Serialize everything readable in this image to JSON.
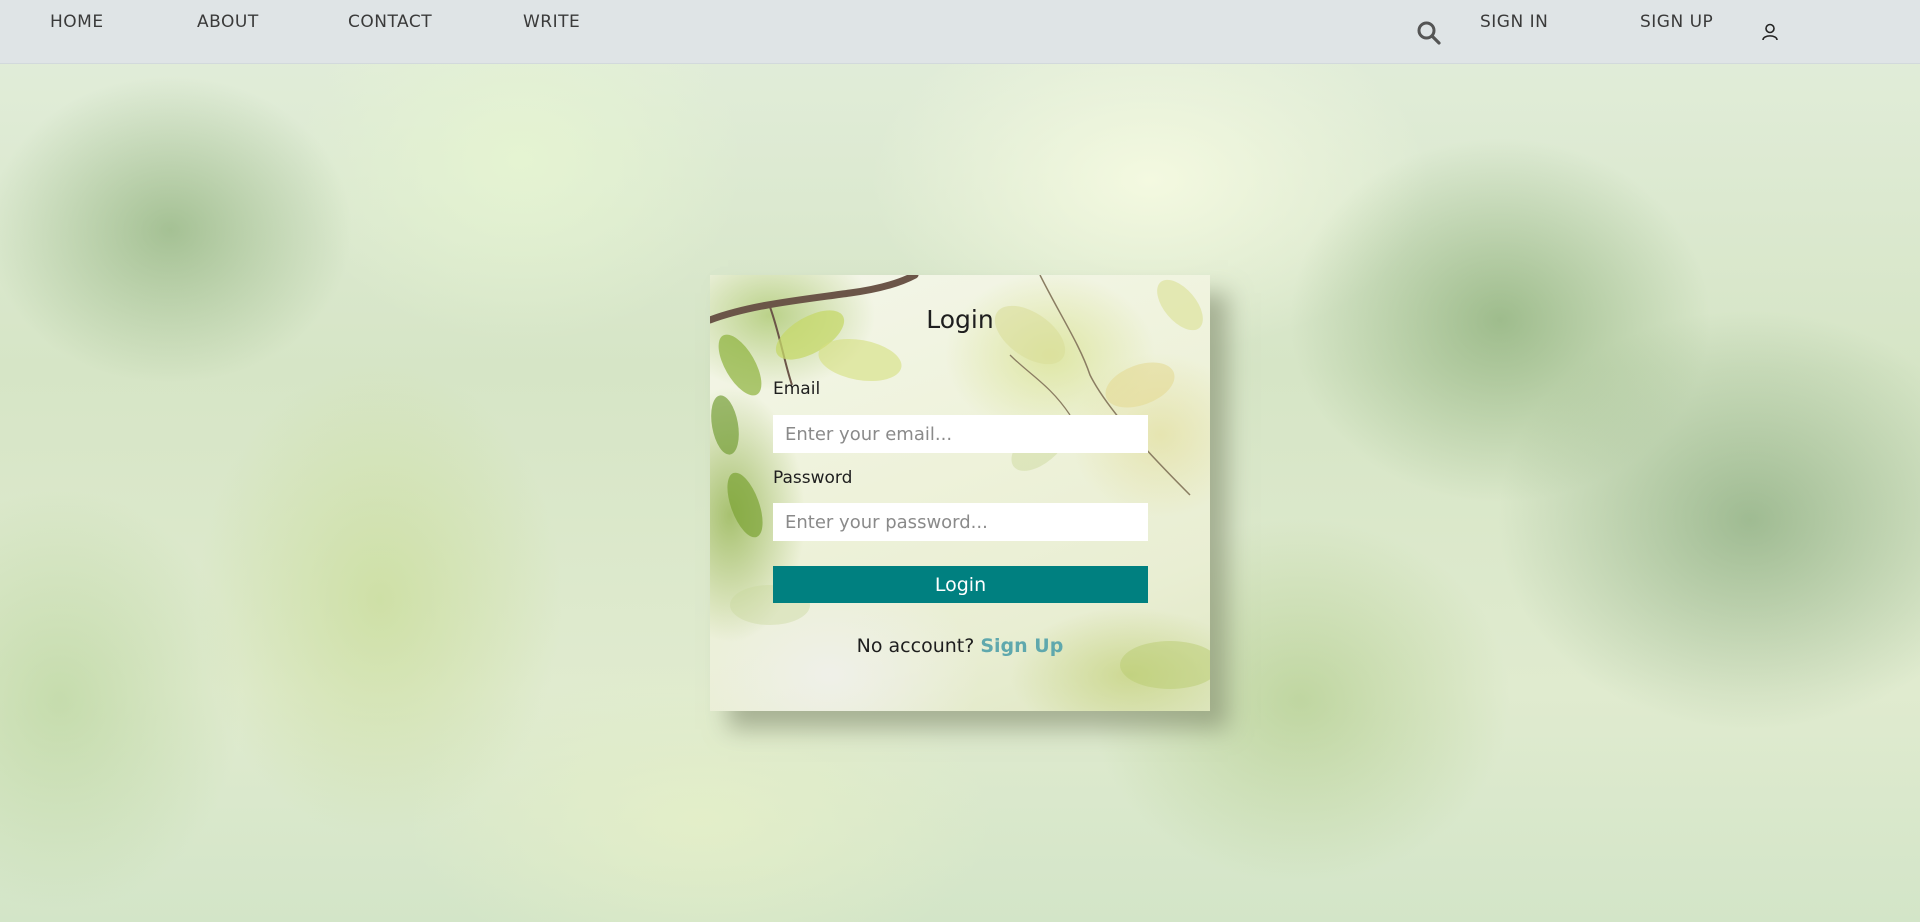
{
  "navbar": {
    "left_links": [
      "HOME",
      "ABOUT",
      "CONTACT",
      "WRITE"
    ],
    "right_links": [
      "SIGN IN",
      "SIGN UP"
    ],
    "icons": [
      "search-icon",
      "user-icon"
    ]
  },
  "login": {
    "title": "Login",
    "email_label": "Email",
    "email_placeholder": "Enter your email...",
    "email_value": "",
    "password_label": "Password",
    "password_placeholder": "Enter your password...",
    "password_value": "",
    "submit_label": "Login",
    "no_account_text": "No account?",
    "signup_link": "Sign Up"
  },
  "colors": {
    "navbar_bg": "#dfe4e6",
    "button_bg": "#008080",
    "link": "#5fa8ad"
  }
}
